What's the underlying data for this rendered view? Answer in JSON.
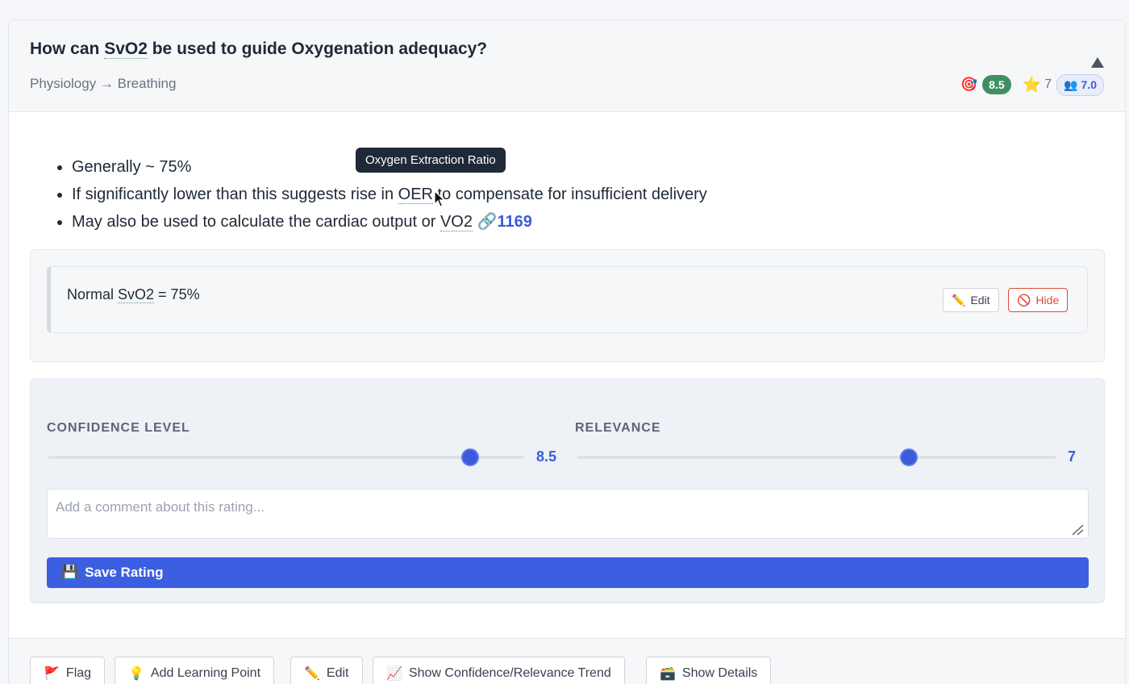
{
  "header": {
    "title_prefix": "How can ",
    "title_term": "SvO2",
    "title_suffix": " be used to guide Oxygenation adequacy?",
    "breadcrumb": "Physiology → Breathing",
    "score_icon": "🎯",
    "score": "8.5",
    "star_icon": "⭐",
    "star_count": "7",
    "community_icon": "👥",
    "community_score": "7.0"
  },
  "content": {
    "bullet1": "Generally ~ 75%",
    "bullet2_prefix": "If significantly lower than this suggests rise in ",
    "bullet2_term": "OER",
    "bullet2_suffix": " to compensate for insufficient delivery",
    "bullet3_prefix": "May also be used to calculate the cardiac output or ",
    "bullet3_term": "VO2",
    "bullet3_link_icon": "🔗",
    "bullet3_link": "1169",
    "tooltip": "Oxygen Extraction Ratio"
  },
  "learning_point": {
    "text_prefix": "Normal ",
    "text_term": "SvO2",
    "text_suffix": " = 75%",
    "edit_icon": "✏️",
    "edit_label": "Edit",
    "hide_icon": "🚫",
    "hide_label": "Hide"
  },
  "rating": {
    "confidence_label": "CONFIDENCE LEVEL",
    "confidence_value": "8.5",
    "relevance_label": "RELEVANCE",
    "relevance_value": "7",
    "comment_placeholder": "Add a comment about this rating...",
    "save_icon": "💾",
    "save_label": "Save Rating"
  },
  "footer": {
    "flag_icon": "🚩",
    "flag_label": "Flag",
    "add_lp_icon": "💡",
    "add_lp_label": "Add Learning Point",
    "edit_icon": "✏️",
    "edit_label": "Edit",
    "trend_icon": "📈",
    "trend_label": "Show Confidence/Relevance Trend",
    "details_icon": "🗃️",
    "details_label": "Show Details"
  },
  "colors": {
    "accent": "#3b5bdb",
    "score_badge": "#3f8f62",
    "hide_red": "#dc4a3c"
  }
}
